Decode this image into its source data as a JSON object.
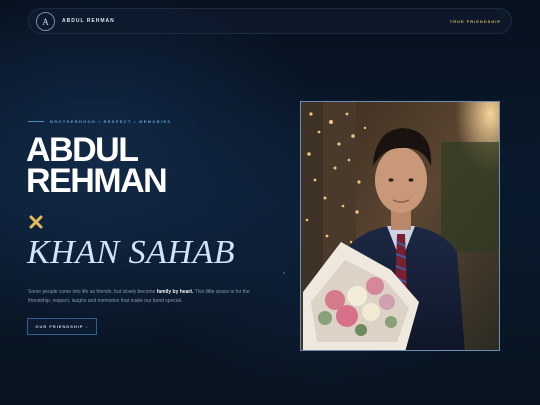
{
  "nav": {
    "logo_letter": "A",
    "brand": "ABDUL REHMAN",
    "link": "TRUE FRIENDSHIP"
  },
  "hero": {
    "tagline": "BROTHERHOOD • RESPECT • MEMORIES",
    "title_line1": "ABDUL",
    "title_line2": "REHMAN",
    "subtitle": "KHAN SAHAB",
    "desc_pre": "Some people come into life as friends, but slowly become ",
    "desc_bold": "family by heart.",
    "desc_post": " This little space is for the friendship, respect, laughs and memories that make our bond special.",
    "cta": "OUR FRIENDSHIP ↓"
  },
  "colors": {
    "accent_gold": "#d8b25c",
    "accent_blue": "#5e9fd6",
    "background": "#0a1a2e"
  },
  "icons": {
    "cross": "cross-icon",
    "logo": "logo-badge"
  }
}
